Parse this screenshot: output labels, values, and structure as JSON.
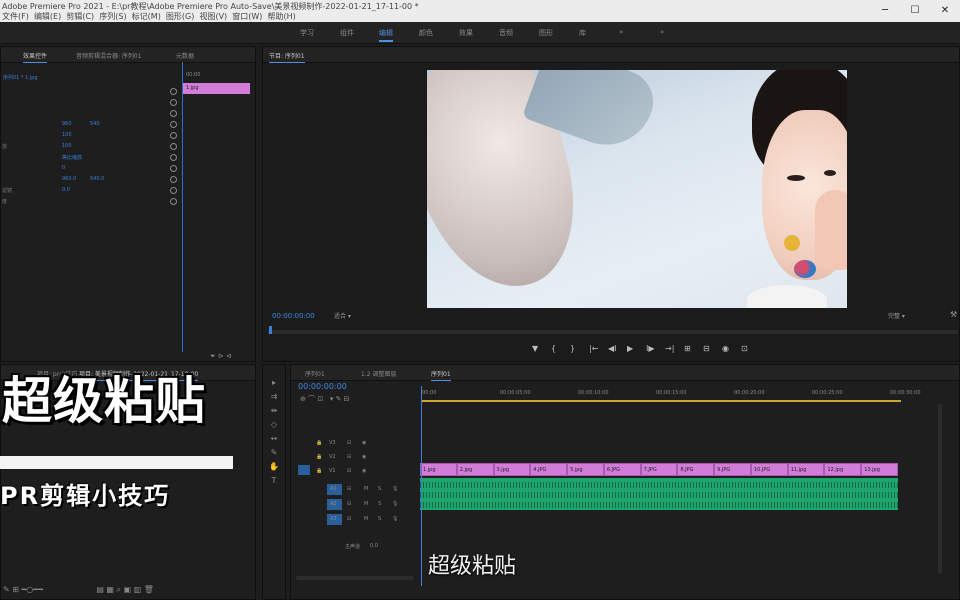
{
  "titlebar": {
    "title": "Adobe Premiere Pro 2021 - E:\\pr教程\\Adobe Premiere Pro Auto-Save\\美景视频制作-2022-01-21_17-11-00 *",
    "menu": [
      "文件(F)",
      "编辑(E)",
      "剪辑(C)",
      "序列(S)",
      "标记(M)",
      "图形(G)",
      "视图(V)",
      "窗口(W)",
      "帮助(H)"
    ]
  },
  "workspaces": [
    {
      "label": "学习",
      "active": false
    },
    {
      "label": "组件",
      "active": false
    },
    {
      "label": "编辑",
      "active": true
    },
    {
      "label": "颜色",
      "active": false
    },
    {
      "label": "效果",
      "active": false
    },
    {
      "label": "音频",
      "active": false
    },
    {
      "label": "图形",
      "active": false
    },
    {
      "label": "库",
      "active": false
    },
    {
      "label": "»",
      "active": false
    }
  ],
  "effect_controls": {
    "tabs": [
      "效果控件",
      "音频剪辑混合器: 序列01",
      "元数据"
    ],
    "clip_label": "序列01 * 1.jpg",
    "rows": [
      {
        "label": "",
        "v1": "",
        "v2": ""
      },
      {
        "label": "",
        "v1": "",
        "v2": ""
      },
      {
        "label": "",
        "v1": "",
        "v2": ""
      },
      {
        "label": "",
        "v1": "960",
        "v2": "540"
      },
      {
        "label": "",
        "v1": "100",
        "v2": ""
      },
      {
        "label": "放",
        "v1": "100",
        "v2": ""
      },
      {
        "label": "",
        "v1": "等比缩放",
        "v2": ""
      },
      {
        "label": "",
        "v1": "0",
        "v2": ""
      },
      {
        "label": "",
        "v1": "960.0",
        "v2": "540.0"
      },
      {
        "label": "滤镜",
        "v1": "0.0",
        "v2": ""
      },
      {
        "label": "度",
        "v1": "",
        "v2": ""
      }
    ],
    "mini_clip": "1.jpg",
    "mini_time": "00:00"
  },
  "program_monitor": {
    "tab": "节目: 序列01",
    "timecode": "00:00:00:00",
    "fit": "适合",
    "quality": "完整",
    "controls": [
      "▼",
      "{",
      "}",
      "|←",
      "◀I",
      "▶",
      "I▶",
      "→|",
      "⊞",
      "⊟",
      "◉",
      "⊡"
    ]
  },
  "project_panel": {
    "tabs": [
      "项目: pr小技巧",
      "项目: 美景视频制作-2022-01-21_17-10-00"
    ]
  },
  "timeline": {
    "tabs": [
      "序列01",
      "1.2 调整图层",
      "序列01"
    ],
    "timecode": "00:00:00:00",
    "ruler": [
      "00:00",
      "00:00:05:00",
      "00:00:10:00",
      "00:00:15:00",
      "00:00:20:00",
      "00:00:25:00",
      "00:00:30:00"
    ],
    "tracks_video": [
      "V3",
      "V2",
      "V1"
    ],
    "tracks_audio": [
      "A1",
      "A2",
      "A3"
    ],
    "master": "主声道",
    "master_value": "0.0",
    "video_clips": [
      "1.jpg",
      "2.jpg",
      "3.jpg",
      "4.JPG",
      "5.jpg",
      "6.JPG",
      "7.JPG",
      "8.JPG",
      "9.JPG",
      "10.JPG",
      "11.jpg",
      "12.jpg",
      "13.jpg"
    ]
  },
  "overlay": {
    "big_title": "超级粘贴",
    "sub_title": "PR剪辑小技巧",
    "subtitle": "超级粘贴"
  },
  "colors": {
    "accent": "#3b7fd6",
    "video_clip": "#d27bd9",
    "audio_clip": "#1ea56f"
  }
}
